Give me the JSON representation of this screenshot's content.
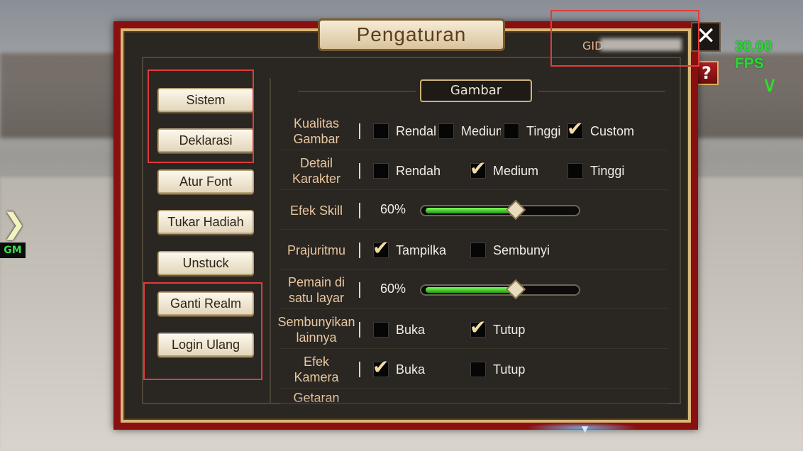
{
  "hud": {
    "fps": "30.00 FPS",
    "gm_badge": "GM",
    "help": "?",
    "close": "✕"
  },
  "panel": {
    "title": "Pengaturan",
    "gid_label": "GID"
  },
  "menu": [
    {
      "label": "Sistem"
    },
    {
      "label": "Deklarasi"
    },
    {
      "label": "Atur Font"
    },
    {
      "label": "Tukar Hadiah"
    },
    {
      "label": "Unstuck"
    },
    {
      "label": "Ganti Realm"
    },
    {
      "label": "Login Ulang"
    }
  ],
  "section": {
    "label": "Gambar"
  },
  "rows": {
    "kualitas": {
      "label": "Kualitas Gambar",
      "options": [
        "Rendah",
        "Medium",
        "Tinggi",
        "Custom"
      ],
      "selected": "Custom"
    },
    "detail": {
      "label": "Detail Karakter",
      "options": [
        "Rendah",
        "Medium",
        "Tinggi"
      ],
      "selected": "Medium"
    },
    "efek_skill": {
      "label": "Efek Skill",
      "value_text": "60%",
      "value": 0.6
    },
    "prajurit": {
      "label": "Prajuritmu",
      "options": [
        "Tampilka",
        "Sembunyi"
      ],
      "selected": "Tampilka"
    },
    "pemain": {
      "label": "Pemain di satu layar",
      "value_text": "60%",
      "value": 0.6
    },
    "sembunyikan": {
      "label": "Sembunyikan lainnya",
      "options": [
        "Buka",
        "Tutup"
      ],
      "selected": "Tutup"
    },
    "kamera": {
      "label": "Efek Kamera",
      "options": [
        "Buka",
        "Tutup"
      ],
      "selected": "Buka"
    },
    "getaran": {
      "label": "Getaran"
    }
  },
  "colors": {
    "frame_red": "#8a0f10",
    "label_gold": "#e8c7a0",
    "fps_green": "#2ed72f",
    "highlight_red": "#e03c3c"
  }
}
